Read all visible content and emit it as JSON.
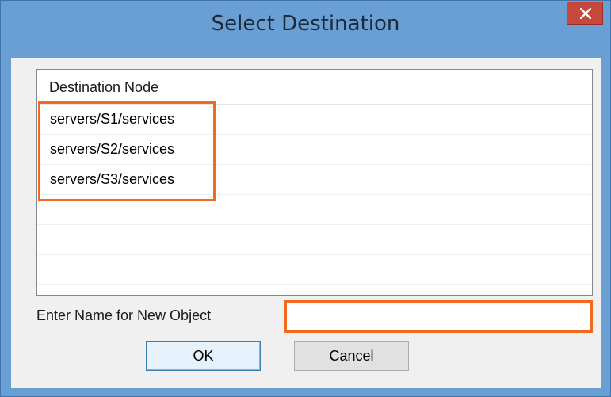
{
  "dialog": {
    "title": "Select Destination",
    "close_symbol": "✕"
  },
  "list": {
    "column_header": "Destination Node",
    "rows": [
      "servers/S1/services",
      "servers/S2/services",
      "servers/S3/services",
      "",
      "",
      ""
    ]
  },
  "form": {
    "name_label": "Enter Name for New Object",
    "name_value": ""
  },
  "buttons": {
    "ok_label": "OK",
    "cancel_label": "Cancel"
  },
  "colors": {
    "frame": "#6a9fd4",
    "close_button": "#c7473d",
    "annotation_highlight": "#f26b1d"
  },
  "icons": {
    "close": "close-icon"
  }
}
